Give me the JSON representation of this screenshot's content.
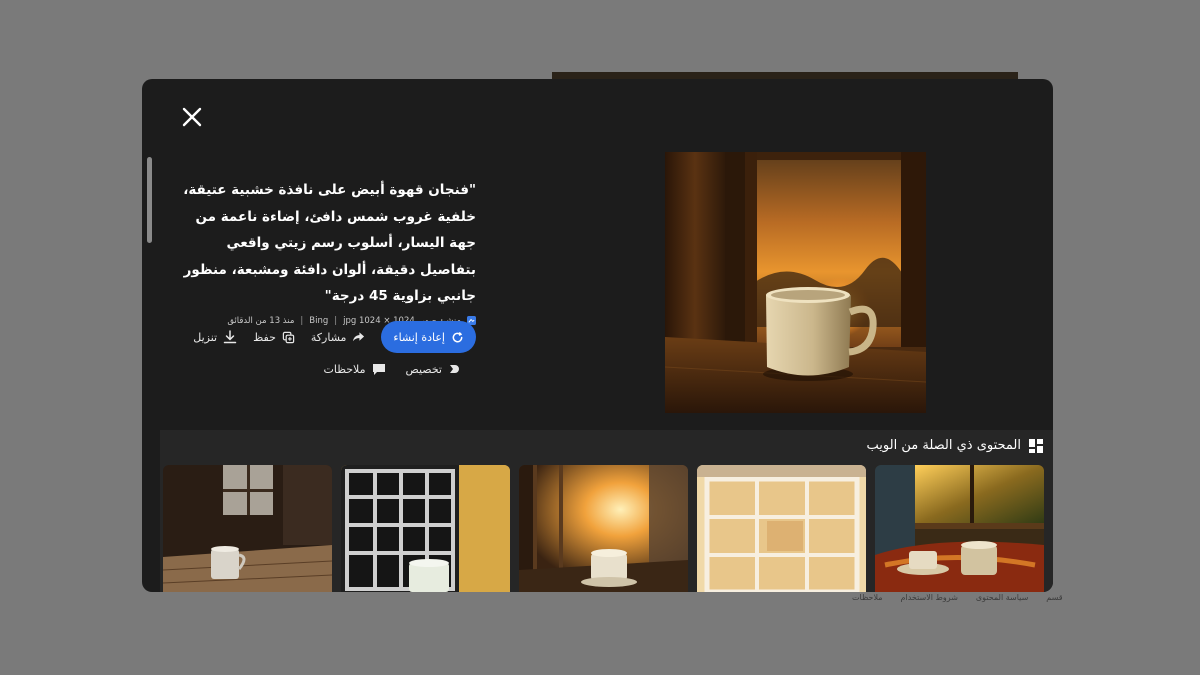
{
  "modal": {
    "prompt": "\"فنجان قهوة أبيض على نافذة خشبية عتيقة، خلفية غروب شمس دافئ، إضاءة ناعمة من جهة اليسار، أسلوب رسم زيتي واقعي بتفاصيل دقيقة، ألوان دافئة ومشبعة، منظور جانبي بزاوية 45 درجة\"",
    "meta": {
      "source": "منشئ صور",
      "format": "jpg 1024 × 1024",
      "engine": "Bing",
      "time": "منذ 13 من الدقائق"
    },
    "actions": {
      "regenerate": "إعادة إنشاء",
      "share": "مشاركة",
      "save": "حفظ",
      "download": "تنزيل",
      "customize": "تخصيص",
      "feedback": "ملاحظات"
    },
    "related": {
      "title": "المحتوى ذي الصلة من الويب"
    }
  },
  "footer": {
    "links": [
      "ملاحظات",
      "شروط الاستخدام",
      "سياسة المحتوى",
      "قسم"
    ]
  },
  "colors": {
    "accent": "#2b6de0",
    "modal_bg": "#1c1c1c",
    "overlay": "#7a7a7a"
  }
}
